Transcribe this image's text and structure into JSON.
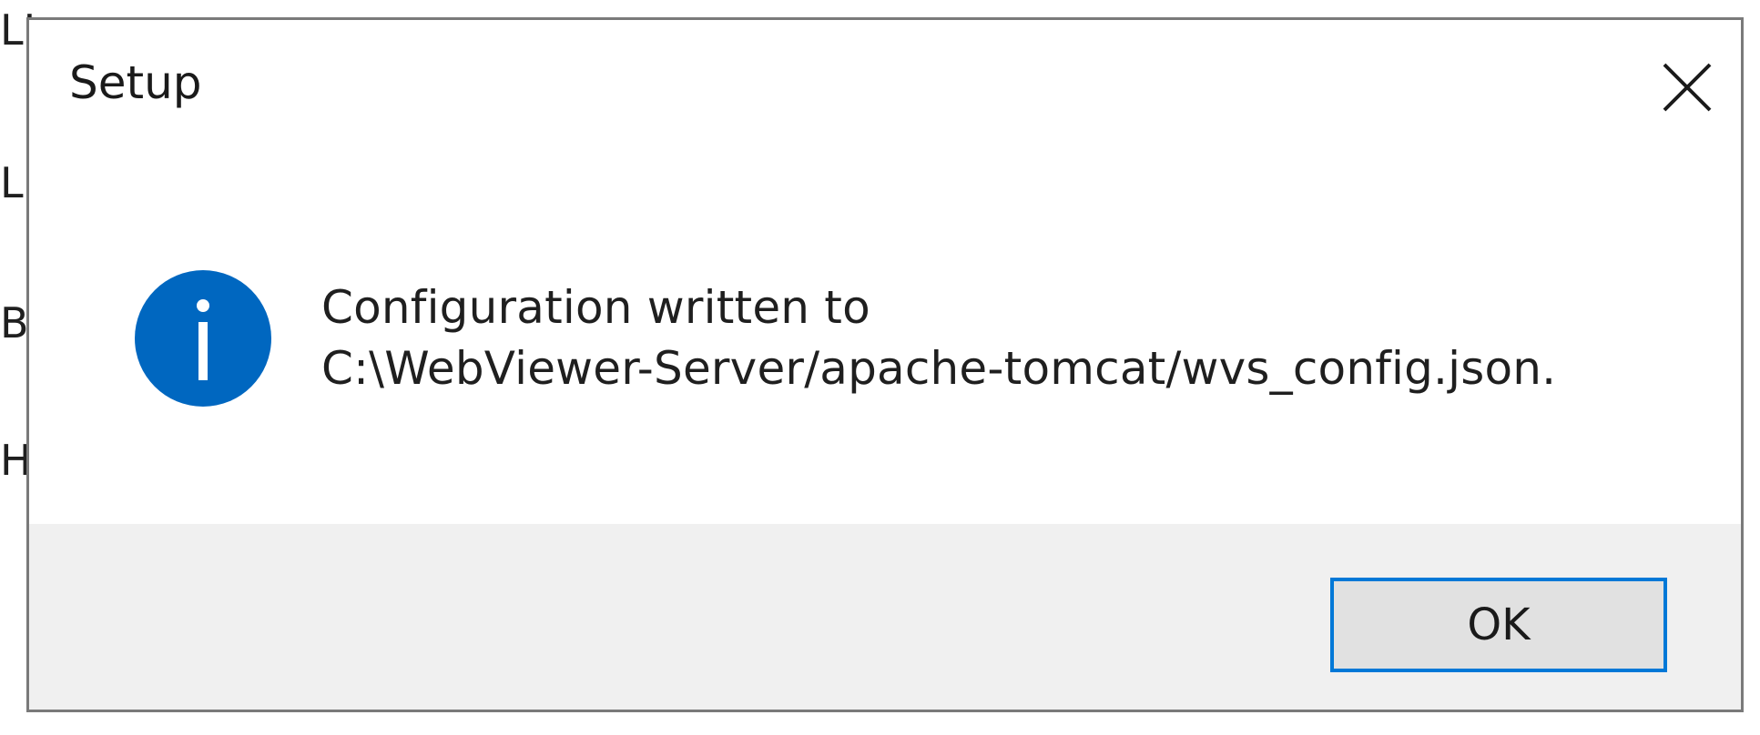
{
  "background": {
    "lines": [
      "LI",
      "LI",
      "BL",
      "H"
    ]
  },
  "dialog": {
    "title": "Setup",
    "close_icon": "close-icon",
    "message_line_1": "Configuration written to",
    "message_line_2": "C:\\WebViewer-Server/apache-tomcat/wvs_config.json.",
    "info_icon": "info-icon",
    "ok_label": "OK"
  },
  "colors": {
    "accent": "#0078d7",
    "info_icon": "#0067c0",
    "footer_bg": "#f0f0f0",
    "button_bg": "#e1e1e1",
    "border": "#7a7a7a"
  }
}
